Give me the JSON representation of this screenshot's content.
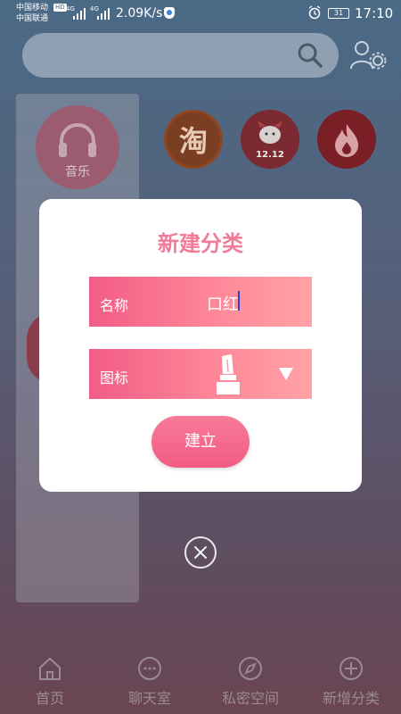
{
  "status_bar": {
    "carrier_1": "中国移动",
    "carrier_2": "中国联通",
    "hd_badge": "HD",
    "network_1": "4G",
    "network_2": "4G",
    "speed": "2.09K/s",
    "battery": "31",
    "time": "17:10"
  },
  "background": {
    "music_label": "音乐",
    "taobao_glyph": "淘",
    "jd_label": "12.12"
  },
  "dialog": {
    "title": "新建分类",
    "name_label": "名称",
    "name_value": "口红",
    "icon_label": "图标",
    "build_button": "建立"
  },
  "bottom_nav": {
    "items": [
      {
        "label": "首页",
        "icon": "home-icon"
      },
      {
        "label": "聊天室",
        "icon": "chat-icon"
      },
      {
        "label": "私密空间",
        "icon": "compass-icon"
      },
      {
        "label": "新增分类",
        "icon": "add-circle-icon"
      }
    ]
  },
  "colors": {
    "accent": "#f25c86",
    "title": "#f07c98"
  }
}
